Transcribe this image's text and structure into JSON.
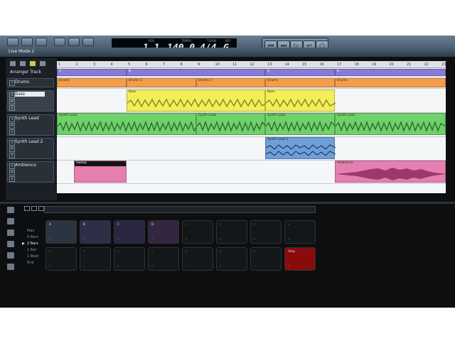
{
  "window": {
    "title": "Live Mode 2"
  },
  "lcd": {
    "pos_label": "POS",
    "pos_value": "1.1",
    "tempo_label": "TEMPO",
    "tempo_value": "140.0",
    "sig_label": "T.SIGN",
    "sig_value": "4/4",
    "key_label": "KEY",
    "key_value": "G"
  },
  "transport": {
    "buttons": [
      "rewind",
      "forward",
      "play",
      "cycle",
      "record"
    ]
  },
  "arranger_track_label": "Arranger Track",
  "tracks": [
    {
      "name": "Drums",
      "num": "1"
    },
    {
      "name": "Bass",
      "num": "2"
    },
    {
      "name": "Synth Lead",
      "num": "3"
    },
    {
      "name": "Synth Lead 2",
      "num": "4"
    },
    {
      "name": "Ambience",
      "num": "5"
    }
  ],
  "ruler": [
    "1",
    "2",
    "3",
    "4",
    "5",
    "6",
    "7",
    "8",
    "9",
    "10",
    "11",
    "12",
    "13",
    "14",
    "15",
    "16",
    "17",
    "18",
    "19",
    "20",
    "21",
    "22",
    "23"
  ],
  "arranger_sections": [
    "A",
    "B",
    "C",
    "A"
  ],
  "clips": {
    "drums": [
      "Drums",
      "Drums 2",
      "Drums 3",
      "Drums",
      "Drums"
    ],
    "bass": [
      "Bass",
      "Bass"
    ],
    "synth_lead": [
      "Synth Lead",
      "Synth Lead",
      "Synth Lead",
      "Synth Lead"
    ],
    "synth_lead2": [
      "Synth Lead 2"
    ],
    "ambience": [
      "Sweep",
      "Ambience"
    ]
  },
  "quantize_options": [
    "Max",
    "4 Bars",
    "2 Bars",
    "1 Bar",
    "1 Beat",
    "End"
  ],
  "quantize_selected": "2 Bars",
  "pads_row1": [
    {
      "label": "A",
      "sub": "–"
    },
    {
      "label": "B",
      "sub": "–"
    },
    {
      "label": "C",
      "sub": "–"
    },
    {
      "label": "D",
      "sub": "–"
    },
    {
      "label": "–",
      "sub": "–"
    },
    {
      "label": "–",
      "sub": "–"
    },
    {
      "label": "–",
      "sub": "–"
    },
    {
      "label": "–",
      "sub": "–"
    }
  ],
  "pads_row2": [
    {
      "label": "–",
      "sub": "–"
    },
    {
      "label": "–",
      "sub": "–"
    },
    {
      "label": "–",
      "sub": "–"
    },
    {
      "label": "–",
      "sub": "–"
    },
    {
      "label": "–",
      "sub": "–"
    },
    {
      "label": "–",
      "sub": "–"
    },
    {
      "label": "–",
      "sub": "–"
    },
    {
      "label": "Stop",
      "sub": "–"
    }
  ],
  "colors": {
    "drums": "#f39c4a",
    "bass": "#f2ee57",
    "synth_lead": "#6fd16a",
    "synth_lead2": "#6f9fd8",
    "ambience": "#e67fb1",
    "stop_pad": "#8a0b0b"
  }
}
